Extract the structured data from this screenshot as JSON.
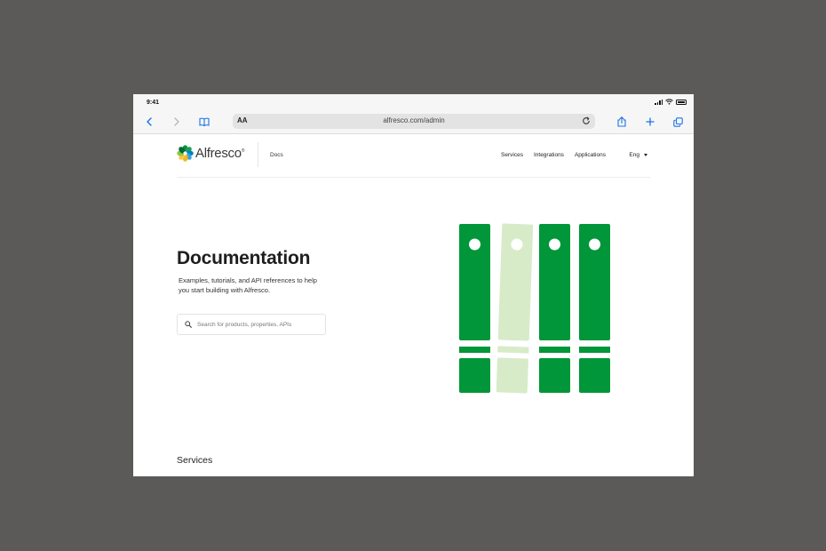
{
  "status_bar": {
    "time": "9:41"
  },
  "browser": {
    "url": "alfresco.com/admin",
    "text_size_label": "AA",
    "icons": [
      "back-icon",
      "forward-icon",
      "bookmarks-icon",
      "reload-icon",
      "share-icon",
      "new-tab-icon",
      "tabs-icon"
    ]
  },
  "header": {
    "logo_text": "Alfresco",
    "logo_mark": "®",
    "docs_link": "Docs",
    "nav": [
      "Services",
      "Integrations",
      "Applications"
    ],
    "language": "Eng"
  },
  "hero": {
    "title": "Documentation",
    "description": "Examples, tutorials, and API references to help you start building with Alfresco.",
    "search_placeholder": "Search for products, properties, APIs"
  },
  "sections": {
    "services_heading": "Services"
  },
  "colors": {
    "brand_green": "#009639",
    "light_green": "#d7ebc9",
    "backdrop": "#5b5a58",
    "link_blue": "#1a73e8"
  }
}
